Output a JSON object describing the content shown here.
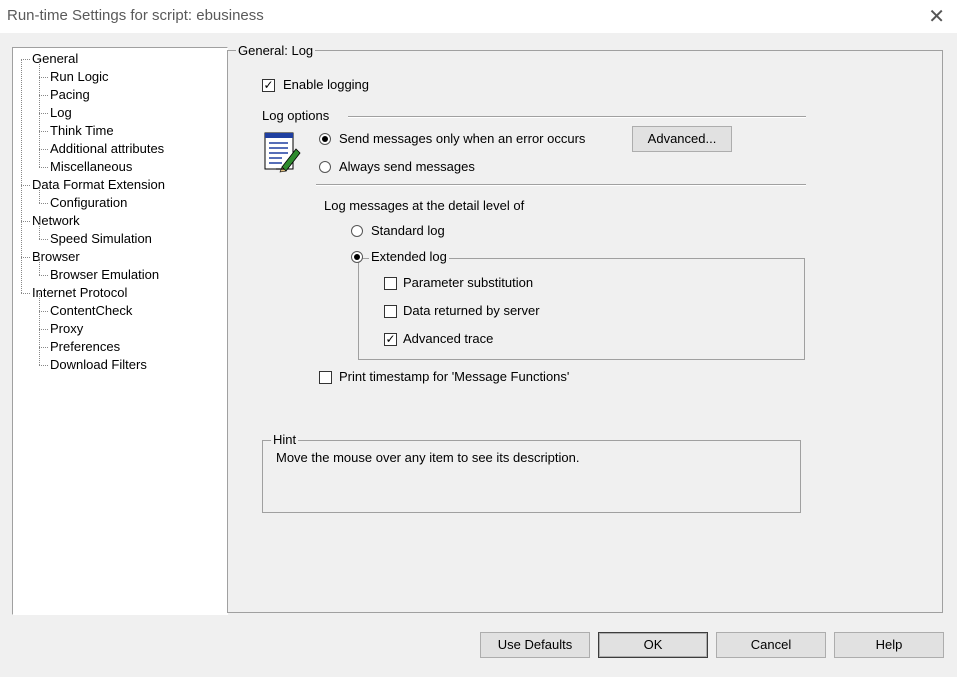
{
  "window": {
    "title": "Run-time Settings for script: ebusiness"
  },
  "tree": {
    "items": [
      {
        "label": "General",
        "level": 0
      },
      {
        "label": "Run Logic",
        "level": 1
      },
      {
        "label": "Pacing",
        "level": 1
      },
      {
        "label": "Log",
        "level": 1,
        "selected": true
      },
      {
        "label": "Think Time",
        "level": 1
      },
      {
        "label": "Additional attributes",
        "level": 1
      },
      {
        "label": "Miscellaneous",
        "level": 1
      },
      {
        "label": "Data Format Extension",
        "level": 0
      },
      {
        "label": "Configuration",
        "level": 1
      },
      {
        "label": "Network",
        "level": 0
      },
      {
        "label": "Speed Simulation",
        "level": 1
      },
      {
        "label": "Browser",
        "level": 0
      },
      {
        "label": "Browser Emulation",
        "level": 1
      },
      {
        "label": "Internet Protocol",
        "level": 0
      },
      {
        "label": "ContentCheck",
        "level": 1
      },
      {
        "label": "Proxy",
        "level": 1
      },
      {
        "label": "Preferences",
        "level": 1
      },
      {
        "label": "Download Filters",
        "level": 1
      }
    ]
  },
  "panel": {
    "title": "General: Log",
    "enable_logging": {
      "label": "Enable logging",
      "checked": true
    },
    "log_options": {
      "label": "Log options",
      "send_on_error": {
        "label": "Send messages only when an error occurs",
        "selected": true
      },
      "always_send": {
        "label": "Always send messages",
        "selected": false
      },
      "advanced_button": "Advanced..."
    },
    "detail": {
      "label": "Log messages at the detail level of",
      "standard": {
        "label": "Standard log",
        "selected": false
      },
      "extended": {
        "label": "Extended log",
        "selected": true
      },
      "param_sub": {
        "label": "Parameter substitution",
        "checked": false
      },
      "data_returned": {
        "label": "Data returned by server",
        "checked": false
      },
      "advanced_trace": {
        "label": "Advanced trace",
        "checked": true
      }
    },
    "print_timestamp": {
      "label": "Print timestamp for 'Message Functions'",
      "checked": false
    },
    "hint": {
      "label": "Hint",
      "text": "Move the mouse over any item to see its description."
    }
  },
  "buttons": {
    "use_defaults": "Use Defaults",
    "ok": "OK",
    "cancel": "Cancel",
    "help": "Help"
  }
}
